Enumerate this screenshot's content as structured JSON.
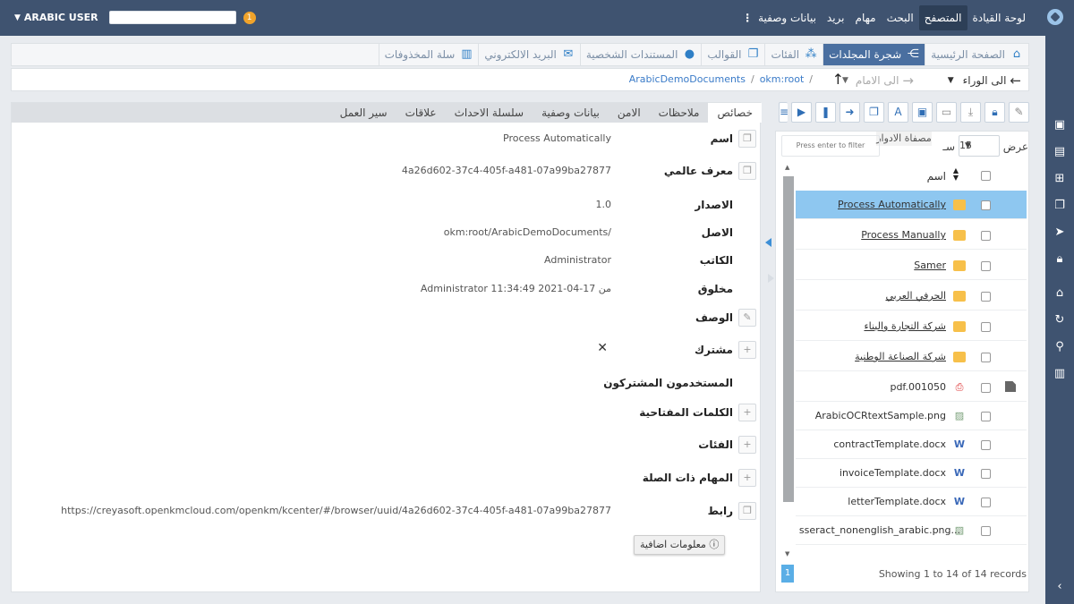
{
  "topbar": {
    "menu": [
      "لوحة القيادة",
      "المتصفح",
      "البحث",
      "مهام",
      "بريد",
      "بيانات وصفية"
    ],
    "active_menu": "المتصفح",
    "user": "ARABIC USER",
    "badge": "1"
  },
  "tabs": [
    {
      "label": "الصفحة الرئيسية",
      "icon": "home-icon",
      "active": false
    },
    {
      "label": "شجرة المجلدات",
      "icon": "tree-icon",
      "active": true
    },
    {
      "label": "الفئات",
      "icon": "categories-icon",
      "active": false
    },
    {
      "label": "القوالب",
      "icon": "templates-icon",
      "active": false
    },
    {
      "label": "المستندات الشخصية",
      "icon": "user-icon",
      "active": false
    },
    {
      "label": "البريد الالكتروني",
      "icon": "mail-icon",
      "active": false
    },
    {
      "label": "سلة المخذوفات",
      "icon": "trash-icon",
      "active": false
    }
  ],
  "nav": {
    "back": "الى الوراء",
    "forward": "الى الامام",
    "breadcrumbs": [
      "okm:root",
      "ArabicDemoDocuments"
    ]
  },
  "props_tabs": [
    "خصائص",
    "ملاحظات",
    "الامن",
    "بيانات وصفية",
    "سلسلة الاحداث",
    "علاقات",
    "سير العمل"
  ],
  "properties": {
    "name_label": "اسم",
    "name_value": "Process Automatically",
    "uuid_label": "معرف عالمي",
    "uuid_value": "4a26d602-37c4-405f-a481-07a99ba27877",
    "version_label": "الاصدار",
    "version_value": "1.0",
    "parent_label": "الاصل",
    "parent_value": "okm:root/ArabicDemoDocuments/",
    "author_label": "الكاتب",
    "author_value": "Administrator",
    "created_label": "مخلوق",
    "created_value": "Administrator 11:34:49 2021-04-17 من",
    "description_label": "الوصف",
    "subscribed_label": "مشترك",
    "subscribers_label": "المستخدمون المشتركون",
    "keywords_label": "الكلمات المفتاحية",
    "categories_label": "الفئات",
    "tasks_label": "المهام ذات الصلة",
    "link_label": "رابط",
    "link_value": "https://creyasoft.openkmcloud.com/openkm/kcenter/#/browser/uuid/4a26d602-37c4-405f-a481-07a99ba27877",
    "extra_info": "معلومات اضافية"
  },
  "list": {
    "show_label": "عرض",
    "page_size": "15",
    "records_label": "سـ",
    "roles_filter": "مصفاة الادوار",
    "filter_placeholder": "Press enter to filter",
    "header_name": "اسم",
    "rows": [
      {
        "name": "Process Automatically",
        "type": "folder",
        "selected": true
      },
      {
        "name": "Process Manually",
        "type": "folder"
      },
      {
        "name": "Samer",
        "type": "folder"
      },
      {
        "name": "الحرفي العربي",
        "type": "folder"
      },
      {
        "name": "شركة التجارة والبناء",
        "type": "folder"
      },
      {
        "name": "شركة الصناعة الوطنية",
        "type": "folder"
      },
      {
        "name": "pdf.001050",
        "type": "pdf"
      },
      {
        "name": "ArabicOCRtextSample.png",
        "type": "png"
      },
      {
        "name": "contractTemplate.docx",
        "type": "docx"
      },
      {
        "name": "invoiceTemplate.docx",
        "type": "docx"
      },
      {
        "name": "letterTemplate.docx",
        "type": "docx"
      },
      {
        "name": "sseract_nonenglish_arabic.png...",
        "type": "png"
      }
    ],
    "page": "1",
    "footer": "Showing 1 to 14 of 14 records"
  },
  "colors": {
    "topbar": "#3f5370",
    "active_tab": "#4a6fa0",
    "selected_row": "#8ec7f0",
    "accent": "#2f7fc6"
  }
}
